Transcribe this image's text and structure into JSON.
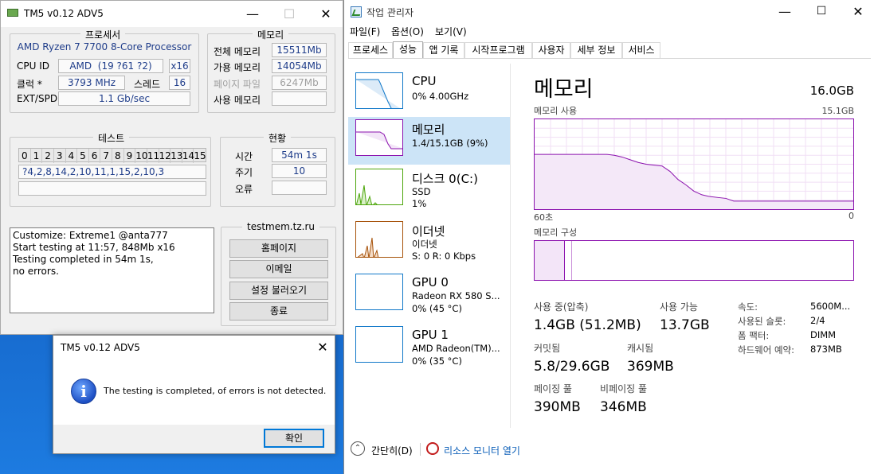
{
  "tm5": {
    "title": "TM5 v0.12 ADV5",
    "processor": {
      "group_title": "프로세서",
      "name": "AMD Ryzen 7 7700 8-Core Processor",
      "cpuid_label": "CPU ID",
      "cpuid_vendor": "AMD",
      "cpuid_value": "(19 ?61 ?2)",
      "cpuid_mult": "x16",
      "clock_label": "클럭 *",
      "clock_value": "3793 MHz",
      "threads_label": "스레드",
      "threads_value": "16",
      "extspd_label": "EXT/SPD",
      "extspd_value": "1.1 Gb/sec"
    },
    "memory": {
      "group_title": "메모리",
      "total_label": "전체 메모리",
      "total_value": "15511Mb",
      "avail_label": "가용 메모리",
      "avail_value": "14054Mb",
      "pagefile_label": "페이지 파일",
      "pagefile_value": "6247Mb",
      "used_label": "사용 메모리",
      "used_value": ""
    },
    "tests": {
      "group_title": "테스트",
      "cells": [
        "0",
        "1",
        "2",
        "3",
        "4",
        "5",
        "6",
        "7",
        "8",
        "9",
        "10",
        "11",
        "12",
        "13",
        "14",
        "15"
      ],
      "sequence": "?4,2,8,14,2,10,11,1,15,2,10,3",
      "progress_text": ""
    },
    "status": {
      "group_title": "현황",
      "time_label": "시간",
      "time_value": "54m 1s",
      "cycle_label": "주기",
      "cycle_value": "10",
      "errors_label": "오류",
      "errors_value": ""
    },
    "log": [
      "Customize: Extreme1 @anta777",
      "Start testing at 11:57, 848Mb x16",
      "Testing completed in 54m 1s,",
      "no errors."
    ],
    "site": "testmem.tz.ru",
    "buttons": {
      "homepage": "홈페이지",
      "email": "이메일",
      "load_settings": "설정 불러오기",
      "exit": "종료"
    }
  },
  "dialog": {
    "title": "TM5 v0.12 ADV5",
    "message": "The testing is completed, of errors is not detected.",
    "ok": "확인"
  },
  "taskmgr": {
    "title": "작업 관리자",
    "menu": [
      "파일(F)",
      "옵션(O)",
      "보기(V)"
    ],
    "tabs": [
      "프로세스",
      "성능",
      "앱 기록",
      "시작프로그램",
      "사용자",
      "세부 정보",
      "서비스"
    ],
    "active_tab": "성능",
    "sidebar": [
      {
        "name": "CPU",
        "line1": "0% 4.00GHz",
        "line2": ""
      },
      {
        "name": "메모리",
        "line1": "1.4/15.1GB (9%)",
        "line2": ""
      },
      {
        "name": "디스크 0(C:)",
        "line1": "SSD",
        "line2": "1%"
      },
      {
        "name": "이더넷",
        "line1": "이더넷",
        "line2": "S: 0 R: 0 Kbps"
      },
      {
        "name": "GPU 0",
        "line1": "Radeon RX 580 S...",
        "line2": "0% (45 °C)"
      },
      {
        "name": "GPU 1",
        "line1": "AMD Radeon(TM)...",
        "line2": "0% (35 °C)"
      }
    ],
    "memory_panel": {
      "heading": "메모리",
      "total": "16.0GB",
      "usage_label": "메모리 사용",
      "usage_max": "15.1GB",
      "x_left": "60초",
      "x_right": "0",
      "composition_label": "메모리 구성",
      "in_use_label": "사용 중(압축)",
      "in_use_value": "1.4GB (51.2MB)",
      "available_label": "사용 가능",
      "available_value": "13.7GB",
      "committed_label": "커밋됨",
      "committed_value": "5.8/29.6GB",
      "cached_label": "캐시됨",
      "cached_value": "369MB",
      "paged_label": "페이징 풀",
      "paged_value": "390MB",
      "nonpaged_label": "비페이징 풀",
      "nonpaged_value": "346MB",
      "speed_label": "속도:",
      "speed_value": "5600M...",
      "slots_label": "사용된 슬롯:",
      "slots_value": "2/4",
      "form_label": "폼 팩터:",
      "form_value": "DIMM",
      "reserved_label": "하드웨어 예약:",
      "reserved_value": "873MB",
      "usage_series_pct": [
        61,
        61,
        61,
        61,
        61,
        61,
        61,
        61,
        61,
        61,
        60,
        58,
        55,
        52,
        50,
        49,
        48,
        42,
        33,
        27,
        20,
        16,
        14,
        13,
        12,
        9,
        9,
        9,
        9,
        9,
        9,
        9,
        9,
        9,
        9,
        9,
        9,
        9,
        9,
        9,
        9
      ]
    },
    "bottom": {
      "collapse": "간단히(D)",
      "resmon": "리소스 모니터 열기"
    },
    "colors": {
      "memory_accent": "#8b12ae",
      "cpu_accent": "#1178c9",
      "disk_accent": "#4da60c",
      "net_accent": "#a7530b",
      "gpu_accent": "#1178c9"
    }
  }
}
